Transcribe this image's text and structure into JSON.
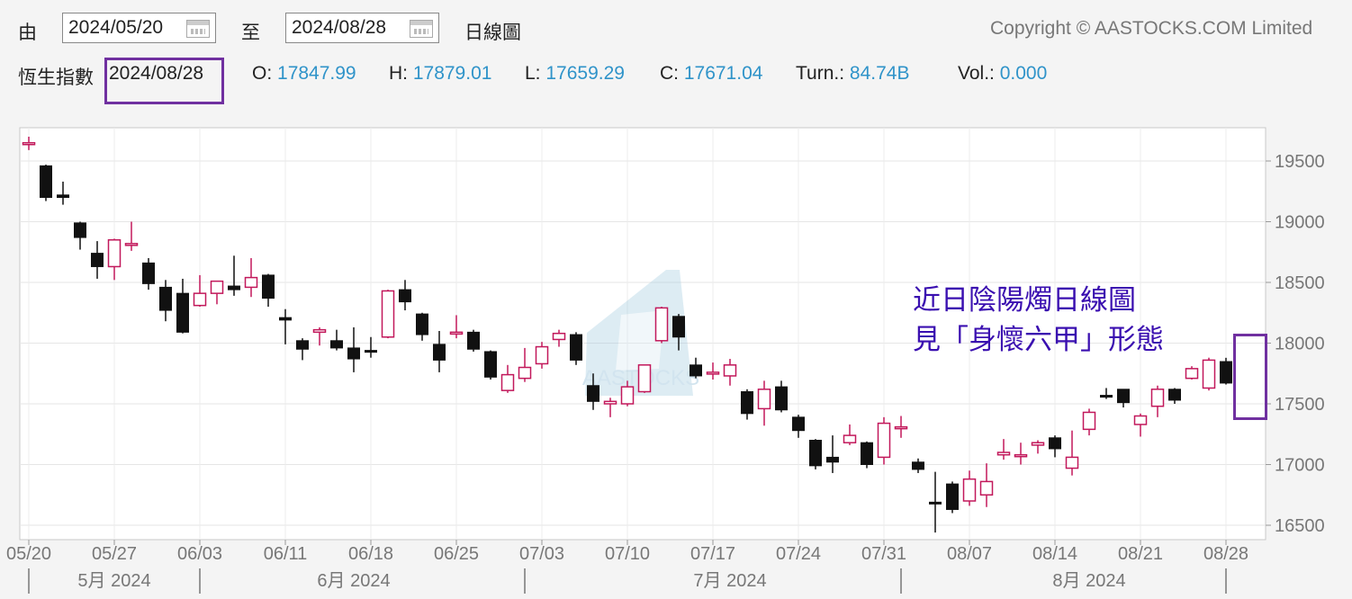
{
  "header": {
    "from_label": "由",
    "from_date": "2024/05/20",
    "to_label": "至",
    "to_date": "2024/08/28",
    "chart_kind": "日線圖",
    "copyright": "Copyright © AASTOCKS.COM Limited"
  },
  "info": {
    "index_name": "恆生指數",
    "date": "2024/08/28",
    "o_label": "O:",
    "o": "17847.99",
    "h_label": "H:",
    "h": "17879.01",
    "l_label": "L:",
    "l": "17659.29",
    "c_label": "C:",
    "c": "17671.04",
    "turn_label": "Turn.:",
    "turn": "84.74B",
    "vol_label": "Vol.:",
    "vol": "0.000"
  },
  "annotation": {
    "line1": "近日陰陽燭日線圖",
    "line2": "見「身懷六甲」形態"
  },
  "watermark": "AASTOCKS",
  "colors": {
    "up": "#c2185b",
    "down": "#111111",
    "value": "#2f93c9",
    "highlight": "#7030a0",
    "annotation": "#3a0fb0"
  },
  "chart_data": {
    "type": "candlestick",
    "y_ticks": [
      "19500",
      "19000",
      "18500",
      "18000",
      "17500",
      "17000",
      "16500"
    ],
    "ylim": [
      16400,
      19750
    ],
    "x_tick_labels": [
      "05/20",
      "05/27",
      "06/03",
      "06/11",
      "06/18",
      "06/25",
      "07/03",
      "07/10",
      "07/17",
      "07/24",
      "07/31",
      "08/07",
      "08/14",
      "08/21",
      "08/28"
    ],
    "x_tick_index": [
      0,
      5,
      10,
      15,
      20,
      25,
      30,
      35,
      40,
      45,
      50,
      55,
      60,
      65,
      70
    ],
    "month_labels": [
      {
        "label": "5月 2024",
        "index": 5
      },
      {
        "label": "6月 2024",
        "index": 19
      },
      {
        "label": "7月 2024",
        "index": 41
      },
      {
        "label": "8月 2024",
        "index": 62
      }
    ],
    "month_boundaries": [
      0,
      10,
      29,
      51,
      70
    ],
    "candles": [
      {
        "o": 19640,
        "h": 19700,
        "l": 19590,
        "c": 19650
      },
      {
        "o": 19460,
        "h": 19470,
        "l": 19170,
        "c": 19200
      },
      {
        "o": 19220,
        "h": 19330,
        "l": 19140,
        "c": 19200
      },
      {
        "o": 18990,
        "h": 19000,
        "l": 18770,
        "c": 18870
      },
      {
        "o": 18740,
        "h": 18840,
        "l": 18530,
        "c": 18630
      },
      {
        "o": 18630,
        "h": 18860,
        "l": 18520,
        "c": 18850
      },
      {
        "o": 18820,
        "h": 19000,
        "l": 18760,
        "c": 18820
      },
      {
        "o": 18660,
        "h": 18700,
        "l": 18440,
        "c": 18490
      },
      {
        "o": 18460,
        "h": 18520,
        "l": 18180,
        "c": 18270
      },
      {
        "o": 18410,
        "h": 18530,
        "l": 18080,
        "c": 18090
      },
      {
        "o": 18310,
        "h": 18560,
        "l": 18300,
        "c": 18410
      },
      {
        "o": 18410,
        "h": 18510,
        "l": 18320,
        "c": 18510
      },
      {
        "o": 18470,
        "h": 18720,
        "l": 18390,
        "c": 18440
      },
      {
        "o": 18460,
        "h": 18700,
        "l": 18380,
        "c": 18540
      },
      {
        "o": 18560,
        "h": 18570,
        "l": 18300,
        "c": 18370
      },
      {
        "o": 18210,
        "h": 18280,
        "l": 17990,
        "c": 18190
      },
      {
        "o": 18020,
        "h": 18040,
        "l": 17860,
        "c": 17950
      },
      {
        "o": 18090,
        "h": 18130,
        "l": 17980,
        "c": 18110
      },
      {
        "o": 18020,
        "h": 18110,
        "l": 17940,
        "c": 17960
      },
      {
        "o": 17960,
        "h": 18130,
        "l": 17760,
        "c": 17870
      },
      {
        "o": 17940,
        "h": 18050,
        "l": 17880,
        "c": 17930
      },
      {
        "o": 18050,
        "h": 18440,
        "l": 18040,
        "c": 18430
      },
      {
        "o": 18440,
        "h": 18520,
        "l": 18270,
        "c": 18340
      },
      {
        "o": 18240,
        "h": 18250,
        "l": 18020,
        "c": 18070
      },
      {
        "o": 17990,
        "h": 18100,
        "l": 17760,
        "c": 17860
      },
      {
        "o": 18080,
        "h": 18230,
        "l": 18040,
        "c": 18090
      },
      {
        "o": 18090,
        "h": 18110,
        "l": 17930,
        "c": 17950
      },
      {
        "o": 17930,
        "h": 17940,
        "l": 17700,
        "c": 17720
      },
      {
        "o": 17610,
        "h": 17820,
        "l": 17590,
        "c": 17740
      },
      {
        "o": 17710,
        "h": 17960,
        "l": 17680,
        "c": 17800
      },
      {
        "o": 17830,
        "h": 18010,
        "l": 17790,
        "c": 17970
      },
      {
        "o": 18030,
        "h": 18110,
        "l": 17970,
        "c": 18080
      },
      {
        "o": 18070,
        "h": 18090,
        "l": 17820,
        "c": 17860
      },
      {
        "o": 17650,
        "h": 17750,
        "l": 17450,
        "c": 17520
      },
      {
        "o": 17500,
        "h": 17550,
        "l": 17390,
        "c": 17520
      },
      {
        "o": 17500,
        "h": 17690,
        "l": 17480,
        "c": 17640
      },
      {
        "o": 17600,
        "h": 17820,
        "l": 17590,
        "c": 17820
      },
      {
        "o": 18020,
        "h": 18300,
        "l": 18000,
        "c": 18290
      },
      {
        "o": 18220,
        "h": 18240,
        "l": 17940,
        "c": 18050
      },
      {
        "o": 17820,
        "h": 17880,
        "l": 17710,
        "c": 17730
      },
      {
        "o": 17760,
        "h": 17840,
        "l": 17700,
        "c": 17760
      },
      {
        "o": 17730,
        "h": 17870,
        "l": 17650,
        "c": 17820
      },
      {
        "o": 17600,
        "h": 17620,
        "l": 17370,
        "c": 17420
      },
      {
        "o": 17460,
        "h": 17690,
        "l": 17320,
        "c": 17620
      },
      {
        "o": 17640,
        "h": 17690,
        "l": 17430,
        "c": 17450
      },
      {
        "o": 17390,
        "h": 17410,
        "l": 17220,
        "c": 17280
      },
      {
        "o": 17200,
        "h": 17210,
        "l": 16960,
        "c": 16990
      },
      {
        "o": 17060,
        "h": 17240,
        "l": 16930,
        "c": 17020
      },
      {
        "o": 17180,
        "h": 17330,
        "l": 17160,
        "c": 17240
      },
      {
        "o": 17180,
        "h": 17190,
        "l": 16970,
        "c": 17000
      },
      {
        "o": 17060,
        "h": 17390,
        "l": 17000,
        "c": 17340
      },
      {
        "o": 17310,
        "h": 17400,
        "l": 17220,
        "c": 17310
      },
      {
        "o": 17020,
        "h": 17050,
        "l": 16930,
        "c": 16960
      },
      {
        "o": 16690,
        "h": 16940,
        "l": 16440,
        "c": 16680
      },
      {
        "o": 16840,
        "h": 16860,
        "l": 16600,
        "c": 16630
      },
      {
        "o": 16700,
        "h": 16950,
        "l": 16660,
        "c": 16880
      },
      {
        "o": 16750,
        "h": 17010,
        "l": 16650,
        "c": 16860
      },
      {
        "o": 17080,
        "h": 17210,
        "l": 17040,
        "c": 17100
      },
      {
        "o": 17080,
        "h": 17180,
        "l": 17000,
        "c": 17080
      },
      {
        "o": 17160,
        "h": 17200,
        "l": 17090,
        "c": 17180
      },
      {
        "o": 17220,
        "h": 17240,
        "l": 17060,
        "c": 17130
      },
      {
        "o": 16970,
        "h": 17280,
        "l": 16910,
        "c": 17060
      },
      {
        "o": 17290,
        "h": 17460,
        "l": 17240,
        "c": 17430
      },
      {
        "o": 17570,
        "h": 17630,
        "l": 17540,
        "c": 17560
      },
      {
        "o": 17620,
        "h": 17620,
        "l": 17470,
        "c": 17510
      },
      {
        "o": 17330,
        "h": 17420,
        "l": 17230,
        "c": 17400
      },
      {
        "o": 17480,
        "h": 17650,
        "l": 17390,
        "c": 17620
      },
      {
        "o": 17620,
        "h": 17630,
        "l": 17500,
        "c": 17530
      },
      {
        "o": 17710,
        "h": 17810,
        "l": 17700,
        "c": 17790
      },
      {
        "o": 17630,
        "h": 17880,
        "l": 17610,
        "c": 17860
      },
      {
        "o": 17848,
        "h": 17879,
        "l": 17659,
        "c": 17671
      }
    ]
  }
}
